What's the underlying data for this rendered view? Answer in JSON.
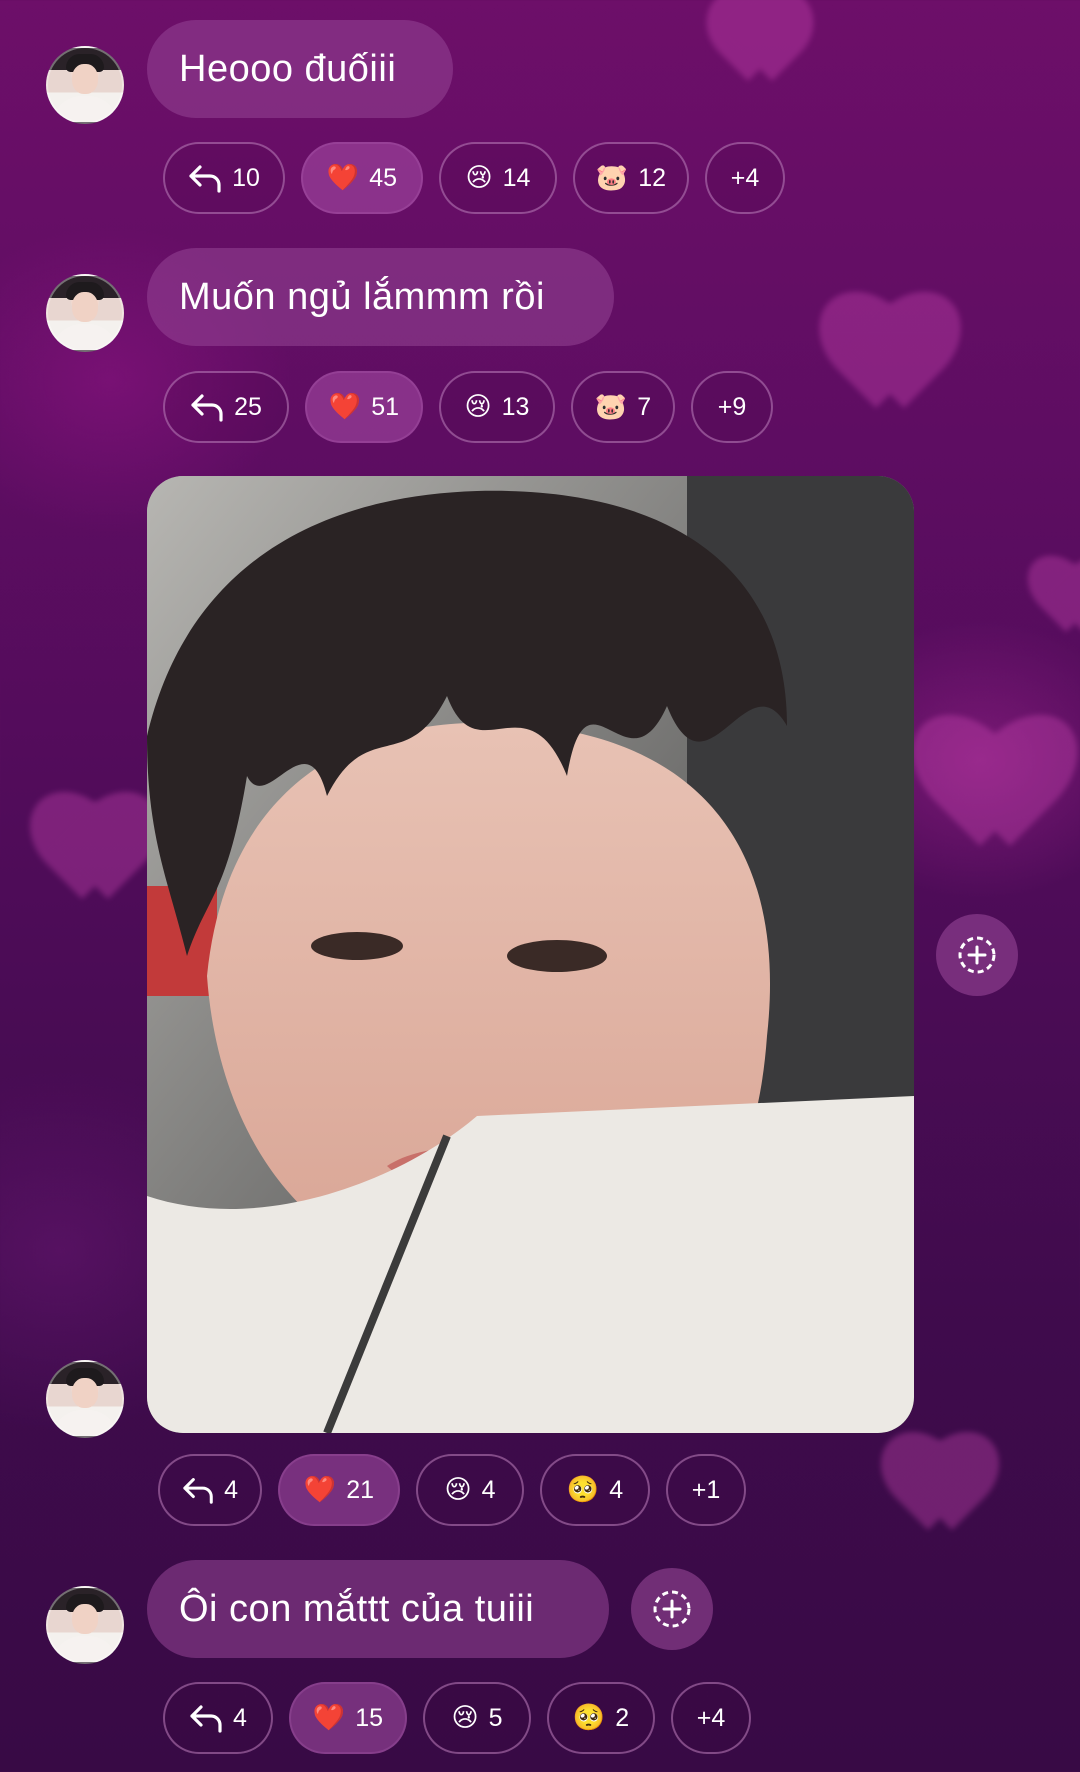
{
  "messages": [
    {
      "text": "Heooo đuốiii",
      "reactions": {
        "reply": "10",
        "heart": "45",
        "cry": "14",
        "pig": "12",
        "more": "+4"
      }
    },
    {
      "text": "Muốn ngủ lắmmm rồi",
      "reactions": {
        "reply": "25",
        "heart": "51",
        "cry": "13",
        "pig": "7",
        "more": "+9"
      }
    },
    {
      "type": "photo",
      "reactions": {
        "reply": "4",
        "heart": "21",
        "cry": "4",
        "pleading": "4",
        "more": "+1"
      }
    },
    {
      "text": "Ôi con mắttt của tuiii",
      "reactions": {
        "reply": "4",
        "heart": "15",
        "cry": "5",
        "pleading": "2",
        "more": "+4"
      }
    }
  ],
  "emojis": {
    "heart": "❤️",
    "cry": "😢",
    "pig": "🐷",
    "pleading": "🥺"
  },
  "colors": {
    "bubble": "#9a4a9a",
    "background_top": "#6d0f69",
    "background_bottom": "#380a45"
  }
}
